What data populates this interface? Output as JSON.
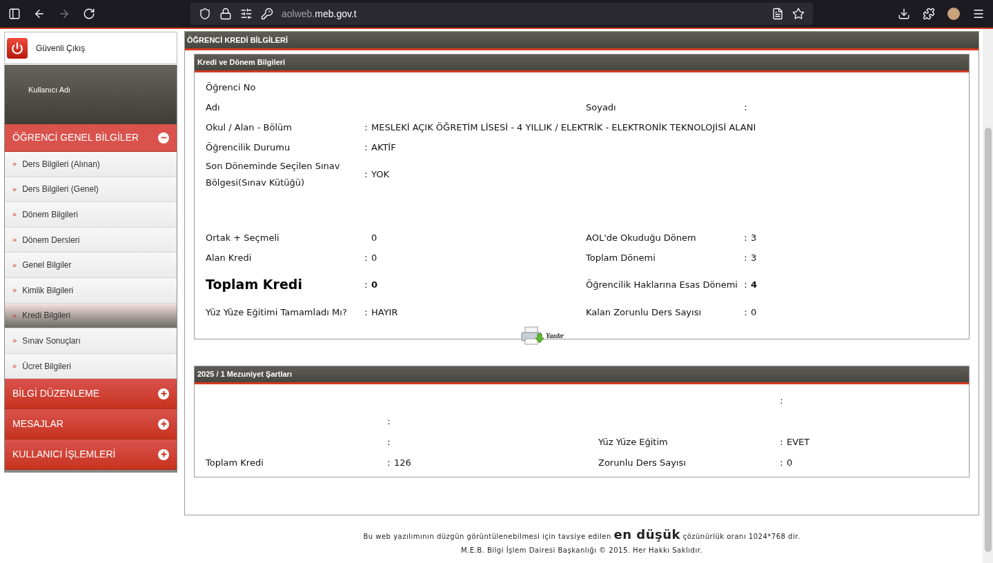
{
  "browser": {
    "url_host": "aolweb.",
    "url_domain": "meb.gov.t",
    "forward_disabled": true
  },
  "sidebar": {
    "logout": "Güvenli Çıkış",
    "user_label": "Kullanıcı Adı",
    "groups": [
      {
        "title": "ÖĞRENCİ GENEL BİLGİLER",
        "expanded": true,
        "children": [
          {
            "bullet": "»",
            "label": "Ders Bilgileri (Alınan)",
            "selected": false
          },
          {
            "bullet": "»",
            "label": "Ders Bilgileri (Genel)",
            "selected": false
          },
          {
            "bullet": "»",
            "label": "Dönem Bilgileri",
            "selected": false
          },
          {
            "bullet": "»",
            "label": "Dönem Dersleri",
            "selected": false
          },
          {
            "bullet": "»",
            "label": "Genel Bilgiler",
            "selected": false
          },
          {
            "bullet": "»",
            "label": "Kimlik Bilgileri",
            "selected": false
          },
          {
            "bullet": "»",
            "label": "Kredi Bilgileri",
            "selected": true
          },
          {
            "bullet": "»",
            "label": "Sınav Sonuçları",
            "selected": false
          },
          {
            "bullet": "»",
            "label": "Ücret Bilgileri",
            "selected": false
          }
        ]
      },
      {
        "title": "BİLGİ DÜZENLEME",
        "expanded": false
      },
      {
        "title": "MESAJLAR",
        "expanded": false
      },
      {
        "title": "KULLANICI İŞLEMLERİ",
        "expanded": false
      }
    ]
  },
  "page_title": "ÖĞRENCİ KREDİ BİLGİLERİ",
  "sections": [
    {
      "kind": "info",
      "title": "Kredi ve Dönem Bilgileri",
      "groups": [
        [
          {
            "left": {
              "label": "Öğrenci No"
            }
          },
          {
            "left": {
              "label": "Adı"
            },
            "right": {
              "label": "Soyadı",
              "sep": ":"
            }
          },
          {
            "left": {
              "label": "Okul / Alan - Bölüm",
              "sep": ":",
              "value": "MESLEKİ AÇIK ÖĞRETİM LİSESİ - 4 YILLIK / ELEKTRİK - ELEKTRONİK TEKNOLOJİSİ ALANI"
            }
          },
          {
            "left": {
              "label": "Öğrencilik Durumu",
              "sep": ":",
              "value": "AKTİF"
            }
          },
          {
            "left": {
              "label": "Son Döneminde Seçilen Sınav Bölgesi(Sınav Kütüğü)",
              "sep": ":",
              "value": "YOK"
            }
          }
        ],
        [
          {
            "left": {
              "label": "Ortak + Seçmeli",
              "value": "0"
            },
            "right": {
              "label": "AOL'de Okuduğu Dönem",
              "sep": ":",
              "value": "3"
            }
          },
          {
            "left": {
              "label": "Alan Kredi",
              "sep": ":",
              "value": "0"
            },
            "right": {
              "label": "Toplam Dönemi",
              "sep": ":",
              "value": "3"
            }
          },
          {
            "left": {
              "label": "Toplam Kredi",
              "sep": ":",
              "value": "0",
              "emphasis": true,
              "large": true
            },
            "right": {
              "label": "Öğrencilik Haklarına Esas Dönemi",
              "sep": ":",
              "value": "4",
              "emphasis": true
            }
          },
          {
            "left": {
              "label": "Yüz Yüze Eğitimi Tamamladı Mı?",
              "sep": ":",
              "value": "HAYIR"
            },
            "right": {
              "label": "Kalan Zorunlu Ders Sayısı",
              "sep": ":",
              "value": "0"
            }
          }
        ]
      ],
      "print_label": "Yazdır"
    },
    {
      "kind": "conditions",
      "title": "2025 / 1 Mezuniyet Şartları",
      "groups": [
        [
          {
            "right": {
              "sep": ":"
            }
          },
          {
            "left": {
              "sep": ":"
            }
          },
          {
            "left": {
              "sep": ":"
            },
            "right": {
              "label": "Yüz Yüze Eğitim",
              "sep": ":",
              "value": "EVET"
            }
          },
          {
            "left": {
              "label": "Toplam Kredi",
              "sep": ":",
              "value": "126"
            },
            "right": {
              "label": "Zorunlu Ders Sayısı",
              "sep": ":",
              "value": "0"
            }
          }
        ]
      ]
    }
  ],
  "footer": {
    "line1_before": "Bu web yazılımının düzgün görüntülenebilmesi için tavsiye edilen",
    "line1_emphasis": "en düşük",
    "line1_after": "çözünürlük oranı 1024*768 dir.",
    "line2": "M.E.B. Bilgi İşlem Dairesi Başkanlığı © 2015. Her Hakkı Saklıdır."
  }
}
